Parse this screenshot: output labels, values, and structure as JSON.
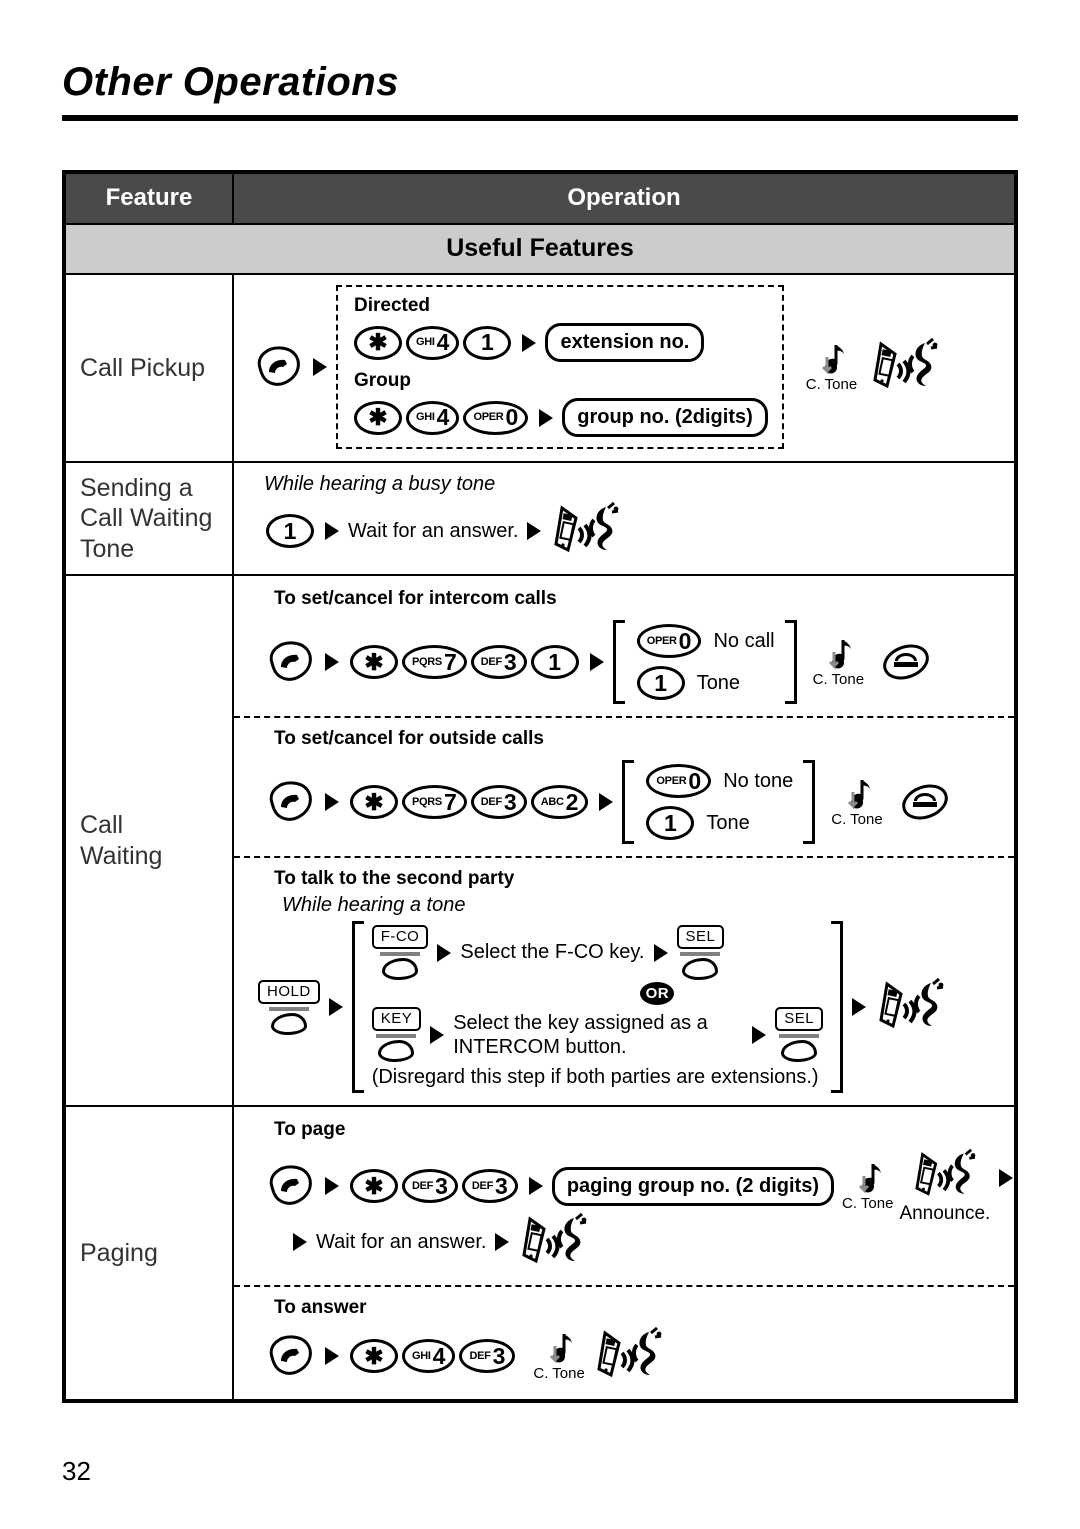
{
  "page": {
    "title": "Other Operations",
    "number": "32"
  },
  "table": {
    "header": {
      "feature": "Feature",
      "operation": "Operation"
    },
    "section_title": "Useful Features",
    "rows": [
      {
        "feature": "Call Pickup",
        "blocks": [
          {
            "label_directed": "Directed",
            "directed_keys": [
              {
                "sup": "",
                "dig": "✱"
              },
              {
                "sup": "GHI",
                "dig": "4"
              },
              {
                "sup": "",
                "dig": "1"
              }
            ],
            "directed_field": "extension no.",
            "label_group": "Group",
            "group_keys": [
              {
                "sup": "",
                "dig": "✱"
              },
              {
                "sup": "GHI",
                "dig": "4"
              },
              {
                "sup": "OPER",
                "dig": "0"
              }
            ],
            "group_field": "group no. (2digits)",
            "tone_label": "C. Tone"
          }
        ]
      },
      {
        "feature": "Sending a\nCall Waiting\nTone",
        "italic_note": "While hearing a busy tone",
        "key": {
          "sup": "",
          "dig": "1"
        },
        "wait_text": "Wait for an answer."
      },
      {
        "feature": "Call\nWaiting",
        "sub1": {
          "heading": "To set/cancel for intercom calls",
          "keys": [
            {
              "sup": "",
              "dig": "✱"
            },
            {
              "sup": "PQRS",
              "dig": "7"
            },
            {
              "sup": "DEF",
              "dig": "3"
            },
            {
              "sup": "",
              "dig": "1"
            }
          ],
          "options": [
            {
              "key": {
                "sup": "OPER",
                "dig": "0"
              },
              "text": "No call"
            },
            {
              "key": {
                "sup": "",
                "dig": "1"
              },
              "text": "Tone"
            }
          ],
          "tone_label": "C. Tone"
        },
        "sub2": {
          "heading": "To set/cancel for outside calls",
          "keys": [
            {
              "sup": "",
              "dig": "✱"
            },
            {
              "sup": "PQRS",
              "dig": "7"
            },
            {
              "sup": "DEF",
              "dig": "3"
            },
            {
              "sup": "ABC",
              "dig": "2"
            }
          ],
          "options": [
            {
              "key": {
                "sup": "OPER",
                "dig": "0"
              },
              "text": "No tone"
            },
            {
              "key": {
                "sup": "",
                "dig": "1"
              },
              "text": "Tone"
            }
          ],
          "tone_label": "C. Tone"
        },
        "sub3": {
          "heading": "To talk to the second party",
          "italic_note": "While hearing a tone",
          "hold_key": "HOLD",
          "opt1_key": "F-CO",
          "opt1_text": "Select the F-CO key.",
          "opt1_sel": "SEL",
          "or_label": "OR",
          "opt2_key": "KEY",
          "opt2_text": "Select the key assigned as a INTERCOM button.",
          "opt2_sel": "SEL",
          "footnote": "(Disregard this step if both parties are extensions.)"
        }
      },
      {
        "feature": "Paging",
        "sub1": {
          "heading": "To page",
          "keys": [
            {
              "sup": "",
              "dig": "✱"
            },
            {
              "sup": "DEF",
              "dig": "3"
            },
            {
              "sup": "DEF",
              "dig": "3"
            }
          ],
          "field": "paging group no. (2 digits)",
          "tone_label": "C. Tone",
          "announce": "Announce.",
          "wait_text": "Wait for an answer."
        },
        "sub2": {
          "heading": "To answer",
          "keys": [
            {
              "sup": "",
              "dig": "✱"
            },
            {
              "sup": "GHI",
              "dig": "4"
            },
            {
              "sup": "DEF",
              "dig": "3"
            }
          ],
          "tone_label": "C. Tone"
        }
      }
    ]
  },
  "colors": {
    "header_bg": "#4a4a4a",
    "section_bg": "#cccccc",
    "text": "#000000"
  }
}
